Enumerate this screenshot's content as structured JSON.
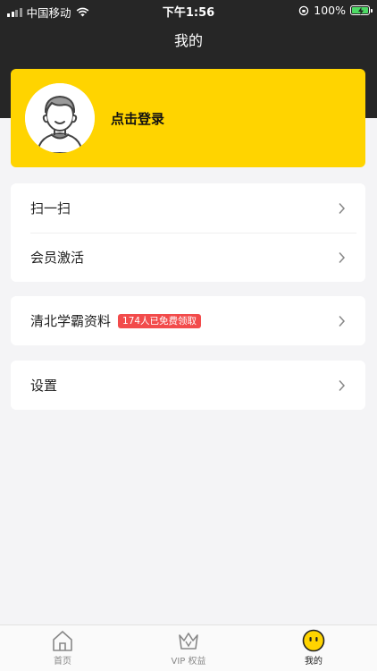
{
  "status_bar": {
    "carrier": "中国移动",
    "time": "下午1:56",
    "battery": "100%"
  },
  "header": {
    "title": "我的"
  },
  "profile": {
    "login_label": "点击登录"
  },
  "menu": {
    "group1": [
      {
        "label": "扫一扫"
      },
      {
        "label": "会员激活"
      }
    ],
    "group2": [
      {
        "label": "清北学霸资料",
        "badge": "174人已免费领取"
      }
    ],
    "group3": [
      {
        "label": "设置"
      }
    ]
  },
  "tabbar": {
    "items": [
      {
        "label": "首页",
        "icon": "home-icon"
      },
      {
        "label": "VIP 权益",
        "icon": "crown-icon"
      },
      {
        "label": "我的",
        "icon": "smiley-face-icon",
        "active": true
      }
    ]
  },
  "colors": {
    "header_bg": "#262626",
    "accent_yellow": "#ffd400",
    "badge_red": "#f24b4b",
    "page_bg": "#f4f4f6"
  }
}
